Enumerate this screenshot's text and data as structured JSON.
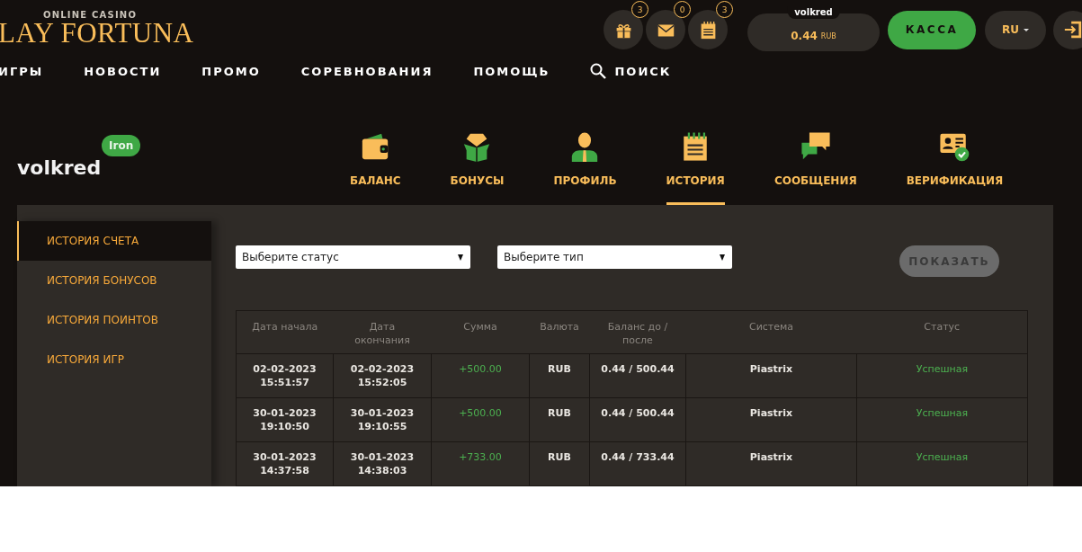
{
  "header": {
    "logo": {
      "tagline": "ONLINE CASINO",
      "name": "LAY FORTUNA"
    },
    "icon_buttons": [
      {
        "kind": "gift",
        "badge": "3"
      },
      {
        "kind": "mail",
        "badge": "0"
      },
      {
        "kind": "notes",
        "badge": "3"
      }
    ],
    "balance": {
      "username": "volkred",
      "amount": "0.44",
      "currency": "RUB"
    },
    "cashier_button": "КАССА",
    "language": "RU"
  },
  "nav": {
    "items": [
      "ИГРЫ",
      "НОВОСТИ",
      "ПРОМО",
      "СОРЕВНОВАНИЯ",
      "ПОМОЩЬ"
    ],
    "search": "ПОИСК"
  },
  "profile": {
    "username": "volkred",
    "level": "Iron"
  },
  "tabs": [
    {
      "kind": "wallet",
      "label": "БАЛАНС",
      "selected": false
    },
    {
      "kind": "bonus",
      "label": "БОНУСЫ",
      "selected": false
    },
    {
      "kind": "person",
      "label": "ПРОФИЛЬ",
      "selected": false
    },
    {
      "kind": "notes",
      "label": "ИСТОРИЯ",
      "selected": true
    },
    {
      "kind": "chat",
      "label": "СООБЩЕНИЯ",
      "selected": false
    },
    {
      "kind": "idcard",
      "label": "ВЕРИФИКАЦИЯ",
      "selected": false
    }
  ],
  "sidebar": {
    "items": [
      {
        "label": "ИСТОРИЯ СЧЕТА",
        "selected": true
      },
      {
        "label": "ИСТОРИЯ БОНУСОВ",
        "selected": false
      },
      {
        "label": "ИСТОРИЯ ПОИНТОВ",
        "selected": false
      },
      {
        "label": "ИСТОРИЯ ИГР",
        "selected": false
      }
    ]
  },
  "filters": [
    {
      "value": "Выберите статус"
    },
    {
      "value": "Выберите тип"
    }
  ],
  "show_button": {
    "label": "ПОКАЗАТЬ",
    "disabled": true
  },
  "table": {
    "columns": [
      {
        "label": "Дата начала",
        "kind": "date"
      },
      {
        "label": "Дата окончания",
        "kind": "date"
      },
      {
        "label": "Сумма",
        "kind": "amount"
      },
      {
        "label": "Валюта",
        "kind": "text"
      },
      {
        "label": "Баланс до / после",
        "kind": "text"
      },
      {
        "label": "Система",
        "kind": "text"
      },
      {
        "label": "Статус",
        "kind": "status"
      }
    ],
    "rows": [
      [
        "02-02-2023 15:51:57",
        "02-02-2023 15:52:05",
        "+500.00",
        "RUB",
        "0.44 / 500.44",
        "Piastrix",
        "Успешная"
      ],
      [
        "30-01-2023 19:10:50",
        "30-01-2023 19:10:55",
        "+500.00",
        "RUB",
        "0.44 / 500.44",
        "Piastrix",
        "Успешная"
      ],
      [
        "30-01-2023 14:37:58",
        "30-01-2023 14:38:03",
        "+733.00",
        "RUB",
        "0.44 / 733.44",
        "Piastrix",
        "Успешная"
      ]
    ]
  }
}
